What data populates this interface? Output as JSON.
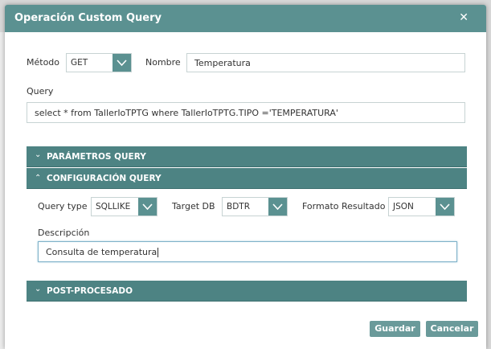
{
  "modal": {
    "title": "Operación Custom Query"
  },
  "fields": {
    "metodo_label": "Método",
    "metodo_value": "GET",
    "nombre_label": "Nombre",
    "nombre_value": "Temperatura",
    "query_label": "Query",
    "query_value": "select * from TallerIoTPTG where TallerIoTPTG.TIPO ='TEMPERATURA'"
  },
  "sections": {
    "parametros": {
      "title": "PARÁMETROS QUERY",
      "expanded": false
    },
    "configuracion": {
      "title": "CONFIGURACIÓN QUERY",
      "expanded": true
    },
    "postprocesado": {
      "title": "POST-PROCESADO",
      "expanded": false
    }
  },
  "config": {
    "query_type_label": "Query type",
    "query_type_value": "SQLLIKE",
    "target_db_label": "Target DB",
    "target_db_value": "BDTR",
    "formato_label": "Formato Resultado",
    "formato_value": "JSON",
    "descripcion_label": "Descripción",
    "descripcion_value": "Consulta de temperatura"
  },
  "buttons": {
    "save": "Guardar",
    "cancel": "Cancelar"
  },
  "colors": {
    "header": "#5b9191",
    "section": "#4d8383",
    "button": "#6a9a9a"
  }
}
